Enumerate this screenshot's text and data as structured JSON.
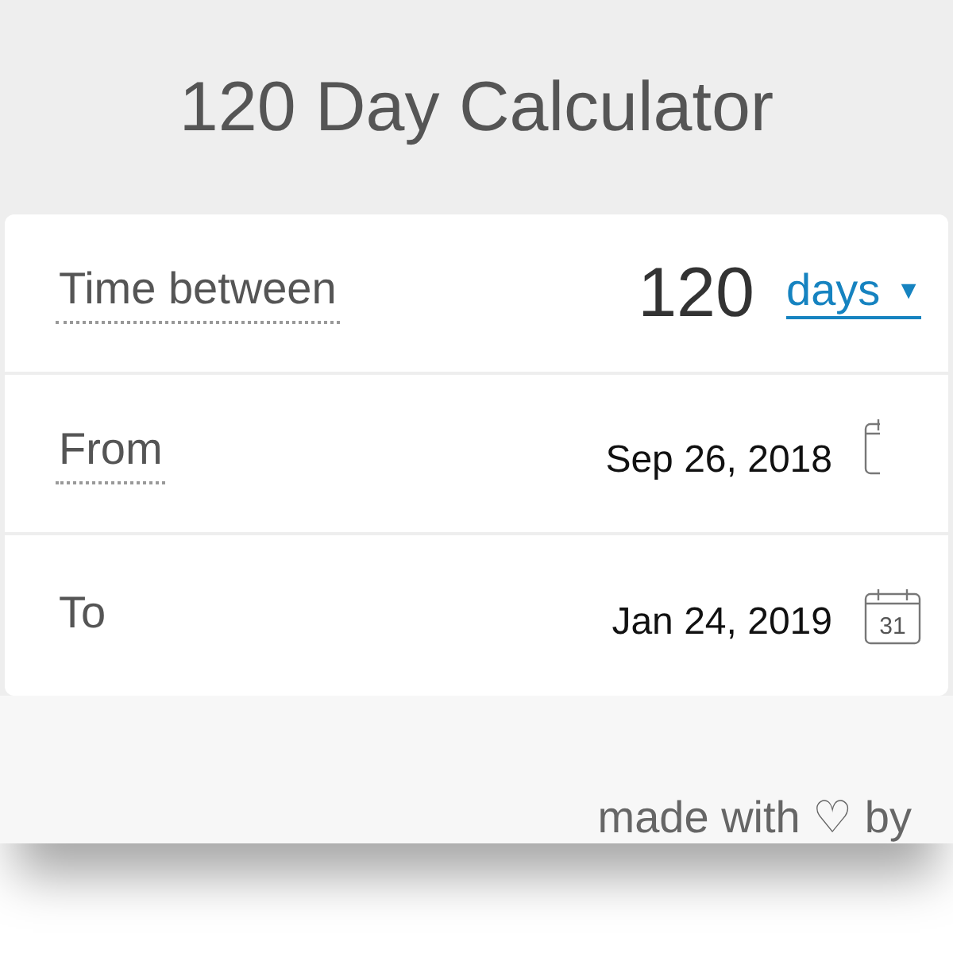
{
  "header": {
    "title": "120 Day Calculator"
  },
  "rows": [
    {
      "kind": "number",
      "label": "Time between",
      "value": "120",
      "unit": "days",
      "caret": "▼"
    },
    {
      "kind": "date",
      "label": "From",
      "value": "Sep 26, 2018",
      "icon_cut": true
    },
    {
      "kind": "date",
      "label": "To",
      "value": "Jan 24, 2019",
      "icon_cut": false,
      "icon_day": "31"
    }
  ],
  "footer": {
    "text": "made with ♡ by"
  }
}
